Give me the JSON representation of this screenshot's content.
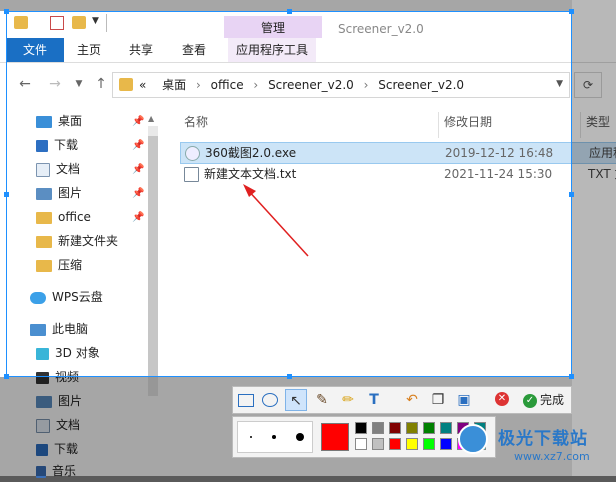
{
  "window": {
    "title": "Screener_v2.0",
    "context_tab": "管理",
    "tabs": [
      "文件",
      "主页",
      "共享",
      "查看",
      "应用程序工具"
    ]
  },
  "address": {
    "prefix": "«",
    "crumbs": [
      "桌面",
      "office",
      "Screener_v2.0",
      "Screener_v2.0"
    ]
  },
  "sidebar": {
    "items": [
      {
        "label": "桌面",
        "icon": "desktop-icon",
        "pinned": true
      },
      {
        "label": "下载",
        "icon": "download-icon",
        "pinned": true
      },
      {
        "label": "文档",
        "icon": "document-icon",
        "pinned": true
      },
      {
        "label": "图片",
        "icon": "picture-icon",
        "pinned": true
      },
      {
        "label": "office",
        "icon": "folder-icon",
        "pinned": true
      },
      {
        "label": "新建文件夹",
        "icon": "folder-icon",
        "pinned": false
      },
      {
        "label": "压缩",
        "icon": "folder-icon",
        "pinned": false
      },
      {
        "label": "WPS云盘",
        "icon": "cloud-icon",
        "pinned": false
      },
      {
        "label": "此电脑",
        "icon": "computer-icon",
        "pinned": false
      },
      {
        "label": "3D 对象",
        "icon": "cube-icon",
        "pinned": false
      },
      {
        "label": "视频",
        "icon": "video-icon",
        "pinned": false
      },
      {
        "label": "图片",
        "icon": "picture-icon",
        "pinned": false
      },
      {
        "label": "文档",
        "icon": "document-icon",
        "pinned": false
      },
      {
        "label": "下载",
        "icon": "download-icon",
        "pinned": false
      },
      {
        "label": "音乐",
        "icon": "music-icon",
        "pinned": false
      }
    ]
  },
  "columns": {
    "name": "名称",
    "date": "修改日期",
    "type": "类型"
  },
  "files": [
    {
      "name": "360截图2.0.exe",
      "date": "2019-12-12 16:48",
      "type": "应用程",
      "selected": true
    },
    {
      "name": "新建文本文档.txt",
      "date": "2021-11-24 15:30",
      "type": "TXT 文",
      "selected": false
    }
  ],
  "toolbar": {
    "done_label": "完成",
    "tools": [
      "rectangle-icon",
      "ellipse-icon",
      "arrow-icon",
      "brush-icon",
      "pencil-icon",
      "text-icon",
      "undo-icon",
      "copy-icon",
      "save-icon"
    ]
  },
  "palette": {
    "current": "#ff0000",
    "colors": [
      "#000000",
      "#808080",
      "#800000",
      "#808000",
      "#008000",
      "#008080",
      "#800080",
      "#008080",
      "#ffffff",
      "#c0c0c0",
      "#ff0000",
      "#ffff00",
      "#00ff00",
      "#0000ff",
      "#ff00ff",
      "#00ffff"
    ]
  },
  "watermark": {
    "name": "极光下载站",
    "url": "www.xz7.com"
  }
}
